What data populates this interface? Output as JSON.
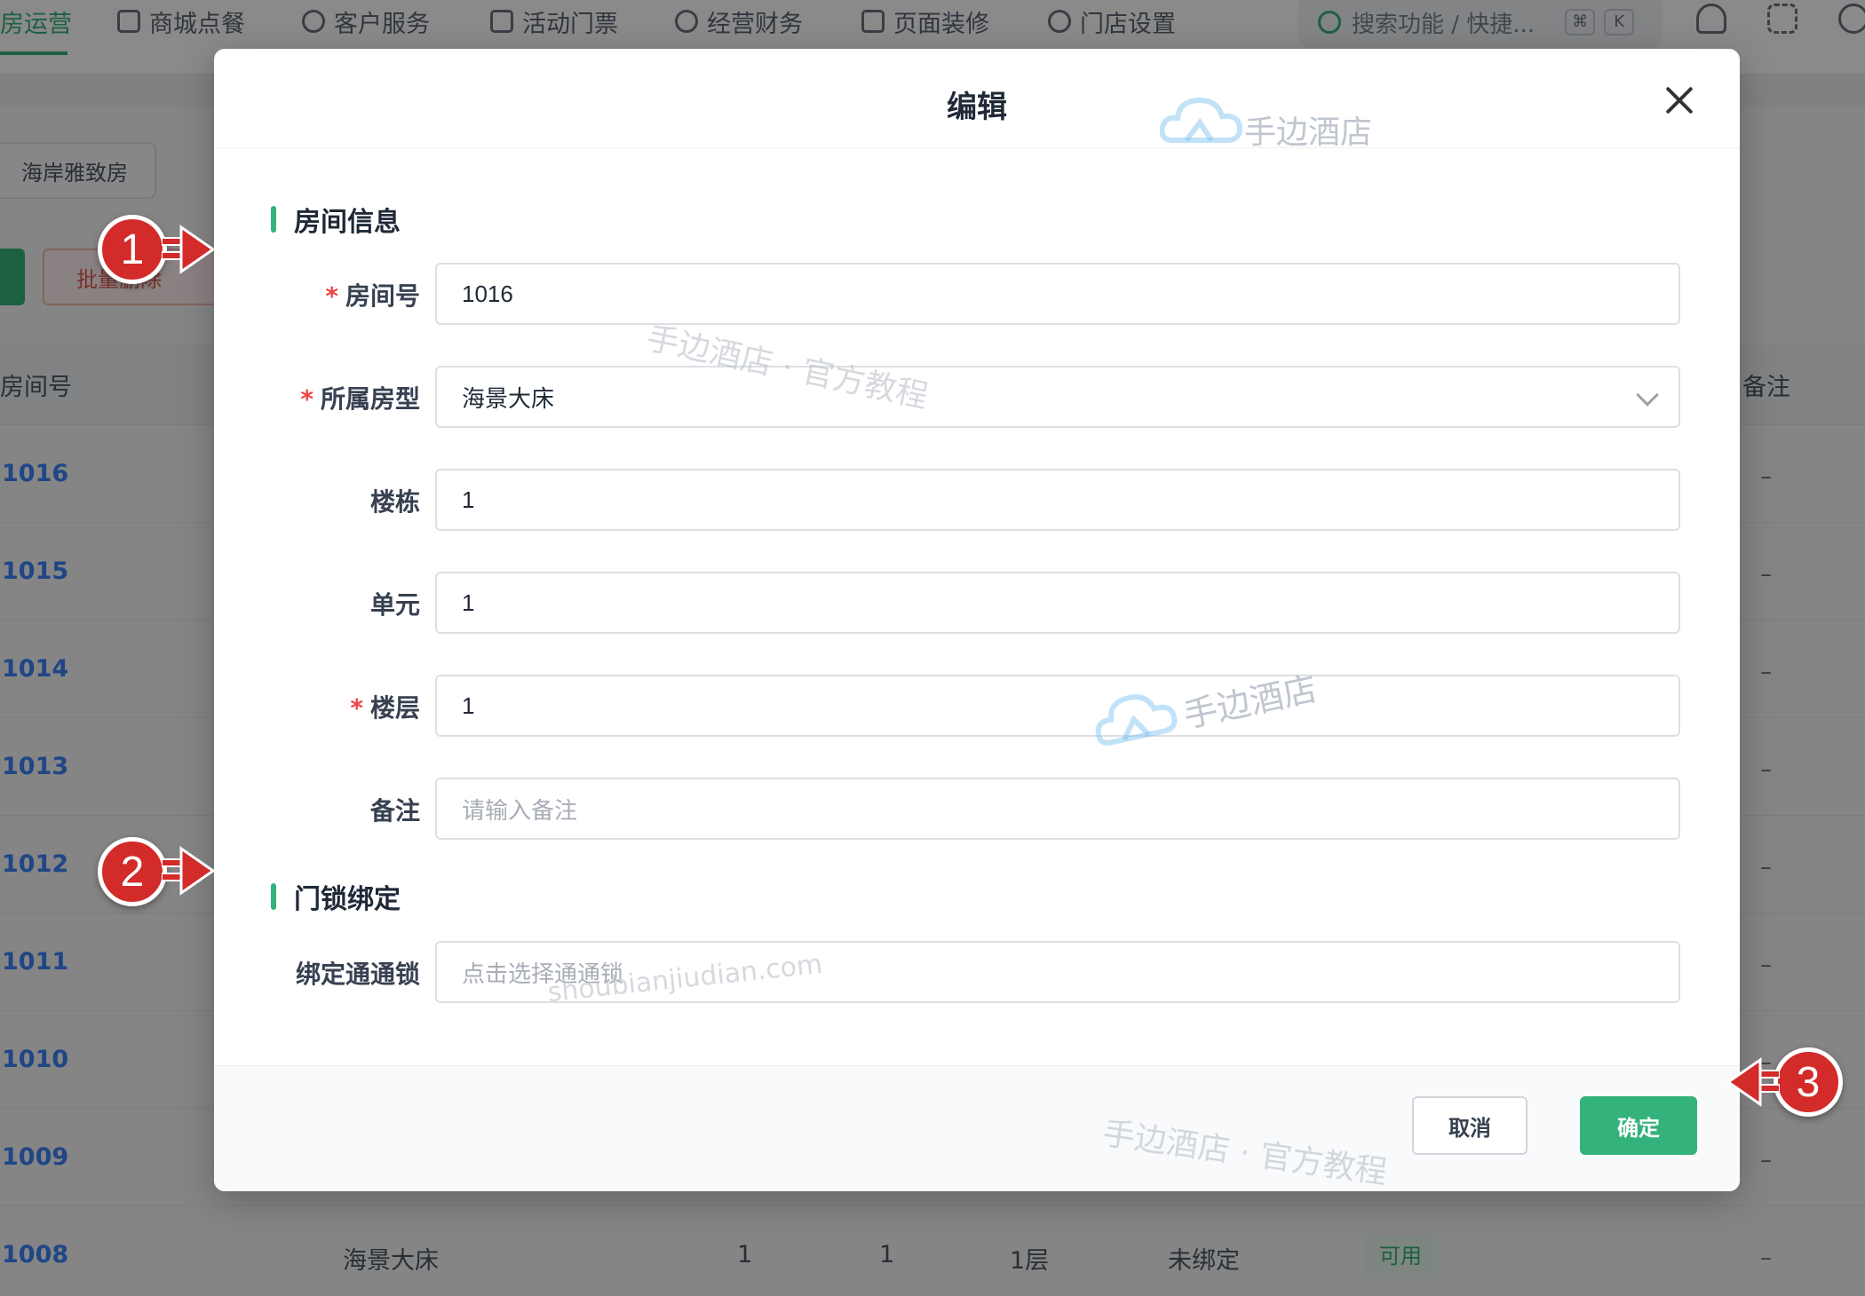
{
  "nav": {
    "items": [
      {
        "label": "房运营",
        "active": true
      },
      {
        "label": "商城点餐"
      },
      {
        "label": "客户服务"
      },
      {
        "label": "活动门票"
      },
      {
        "label": "经营财务"
      },
      {
        "label": "页面装修"
      },
      {
        "label": "门店设置"
      }
    ],
    "search_placeholder": "搜索功能 / 快捷...",
    "kbd1": "⌘",
    "kbd2": "K"
  },
  "background": {
    "chip_label": "海岸雅致房",
    "delete_button": "批量删除",
    "col_room": "房间号",
    "col_note": "备注",
    "rows": [
      "1016",
      "1015",
      "1014",
      "1013",
      "1012",
      "1011",
      "1010",
      "1009",
      "1008"
    ],
    "row_dash": "–",
    "last_row": {
      "type": "海景大床",
      "building": "1",
      "unit": "1",
      "floor": "1层",
      "lock": "未绑定",
      "status": "可用"
    }
  },
  "modal": {
    "title": "编辑",
    "section_room": "房间信息",
    "section_lock": "门锁绑定",
    "fields": {
      "room_no": {
        "label": "房间号",
        "value": "1016",
        "required": true
      },
      "room_type": {
        "label": "所属房型",
        "value": "海景大床",
        "required": true
      },
      "building": {
        "label": "楼栋",
        "value": "1"
      },
      "unit": {
        "label": "单元",
        "value": "1"
      },
      "floor": {
        "label": "楼层",
        "value": "1",
        "required": true
      },
      "note": {
        "label": "备注",
        "placeholder": "请输入备注"
      },
      "lock": {
        "label": "绑定通通锁",
        "placeholder": "点击选择通通锁"
      }
    },
    "required_mark": "*",
    "cancel": "取消",
    "confirm": "确定"
  },
  "watermarks": {
    "brand": "手边酒店",
    "tutorial": "手边酒店 · 官方教程",
    "domain": "shoubianjiudian.com"
  },
  "callouts": [
    "1",
    "2",
    "3"
  ],
  "colors": {
    "accent": "#34b27b",
    "callout": "#d32a2a",
    "required": "#ef4444"
  }
}
